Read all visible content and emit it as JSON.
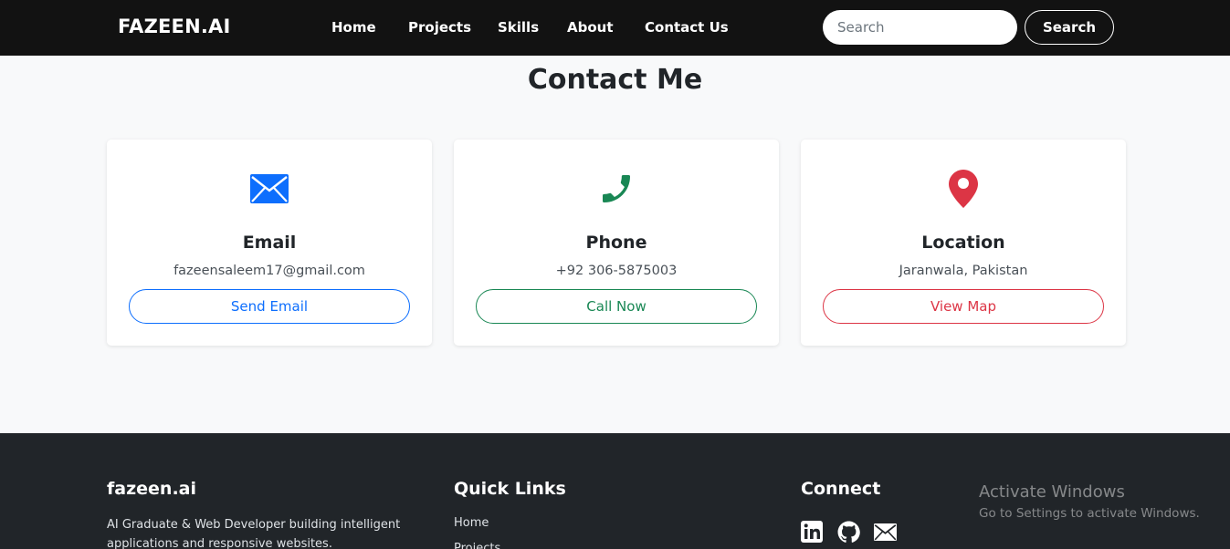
{
  "navbar": {
    "brand": "FAZEEN.AI",
    "links": [
      "Home",
      "Projects",
      "Skills",
      "About",
      "Contact Us"
    ],
    "search_placeholder": "Search",
    "search_button": "Search"
  },
  "page_title": "Contact Me",
  "cards": [
    {
      "title": "Email",
      "text": "fazeensaleem17@gmail.com",
      "button": "Send Email",
      "icon": "envelope-icon",
      "color": "#0d6efd"
    },
    {
      "title": "Phone",
      "text": "+92 306-5875003",
      "button": "Call Now",
      "icon": "phone-icon",
      "color": "#198754"
    },
    {
      "title": "Location",
      "text": "Jaranwala, Pakistan",
      "button": "View Map",
      "icon": "map-pin-icon",
      "color": "#dc3545"
    }
  ],
  "footer": {
    "brand": "fazeen.ai",
    "description_line1": "AI Graduate & Web Developer building intelligent",
    "description_line2": "applications and responsive websites.",
    "quick_links_heading": "Quick Links",
    "quick_links": [
      "Home",
      "Projects"
    ],
    "connect_heading": "Connect",
    "social_icons": [
      "linkedin-icon",
      "github-icon",
      "envelope-icon"
    ]
  },
  "watermark": {
    "title": "Activate Windows",
    "text": "Go to Settings to activate Windows."
  }
}
